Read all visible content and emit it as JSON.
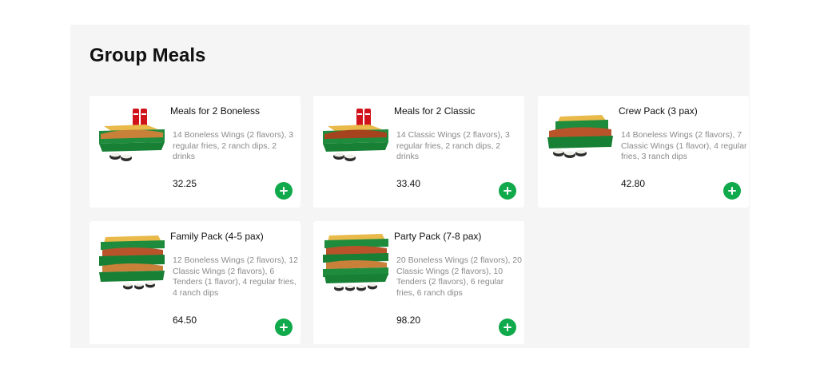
{
  "section": {
    "title": "Group Meals"
  },
  "items": [
    {
      "name": "Meals for 2 Boneless",
      "description": "14 Boneless Wings (2 flavors), 3 regular fries, 2 ranch dips, 2 drinks",
      "price": "32.25",
      "image": "meals-for-2-boneless-photo"
    },
    {
      "name": "Meals for 2 Classic",
      "description": "14 Classic Wings (2 flavors), 3 regular fries, 2 ranch dips, 2 drinks",
      "price": "33.40",
      "image": "meals-for-2-classic-photo"
    },
    {
      "name": "Crew Pack (3 pax)",
      "description": "14 Boneless Wings (2 flavors), 7 Classic Wings (1 flavor), 4 regular fries, 3 ranch dips",
      "price": "42.80",
      "image": "crew-pack-photo"
    },
    {
      "name": "Family Pack (4-5 pax)",
      "description": "12 Boneless Wings (2 flavors), 12 Classic Wings (2 flavors), 6 Tenders (1 flavor), 4 regular fries, 4 ranch dips",
      "price": "64.50",
      "image": "family-pack-photo"
    },
    {
      "name": "Party Pack (7-8 pax)",
      "description": "20 Boneless Wings (2 flavors), 20 Classic Wings (2 flavors), 10 Tenders (2 flavors), 6 regular fries, 6 ranch dips",
      "price": "98.20",
      "image": "party-pack-photo"
    }
  ],
  "icons": {
    "add": "plus-icon"
  },
  "colors": {
    "accent": "#10a94b",
    "panel_background": "#f5f5f5",
    "card_background": "#ffffff",
    "description_text": "#8a8a8a"
  }
}
